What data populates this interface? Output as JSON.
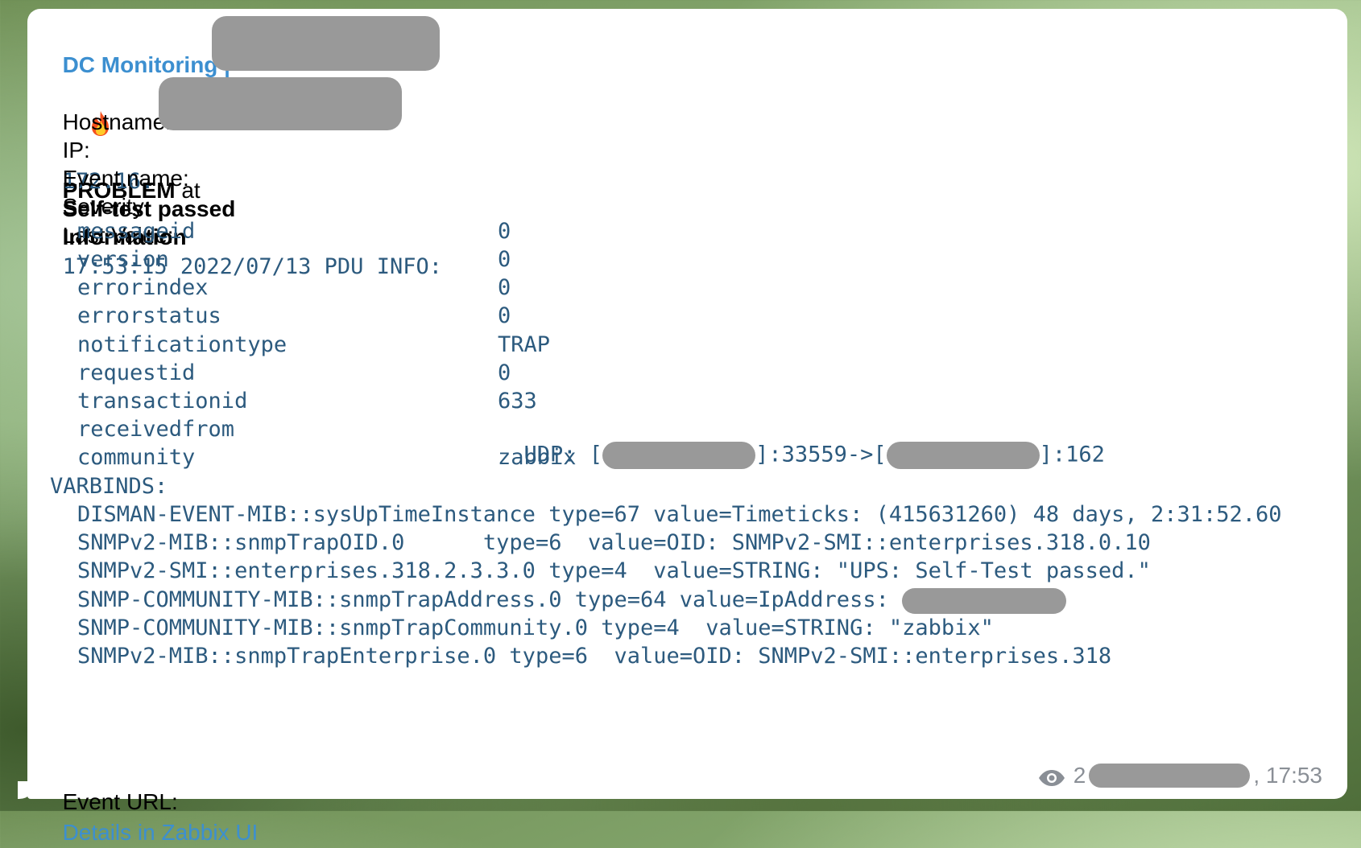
{
  "header": {
    "channel_title": "DC Monitoring |",
    "status_icon": "fire-icon",
    "status_label": "PROBLEM",
    "at_word": " at"
  },
  "fields": {
    "hostname_label": "Hostname:",
    "ip_label": "IP:",
    "ip_value": "172.16.",
    "event_name_label": "Event name:",
    "event_name_value": "Self-test passed",
    "severity_label": "Severity:",
    "severity_value": "Information",
    "last_value_label": "Last Value:",
    "last_value_header": "17:53:15 2022/07/13 PDU INFO:"
  },
  "pdu_info": [
    {
      "key": "messageid",
      "value": "0"
    },
    {
      "key": "version",
      "value": "0"
    },
    {
      "key": "errorindex",
      "value": "0"
    },
    {
      "key": "errorstatus",
      "value": "0"
    },
    {
      "key": "notificationtype",
      "value": "TRAP"
    },
    {
      "key": "requestid",
      "value": "0"
    },
    {
      "key": "transactionid",
      "value": "633"
    },
    {
      "key": "receivedfrom",
      "value": ""
    },
    {
      "key": "community",
      "value": "zabbix"
    }
  ],
  "received_from": {
    "prefix": "UDP: [",
    "middle": "]:33559->[",
    "suffix": "]:162"
  },
  "varbinds": {
    "label": "VARBINDS:",
    "lines": [
      "DISMAN-EVENT-MIB::sysUpTimeInstance type=67 value=Timeticks: (415631260) 48 days, 2:31:52.60",
      "SNMPv2-MIB::snmpTrapOID.0      type=6  value=OID: SNMPv2-SMI::enterprises.318.0.10",
      "SNMPv2-SMI::enterprises.318.2.3.3.0 type=4  value=STRING: \"UPS: Self-Test passed.\"",
      "SNMP-COMMUNITY-MIB::snmpTrapAddress.0 type=64 value=IpAddress: ",
      "SNMP-COMMUNITY-MIB::snmpTrapCommunity.0 type=4  value=STRING: \"zabbix\"",
      "SNMPv2-MIB::snmpTrapEnterprise.0 type=6  value=OID: SNMPv2-SMI::enterprises.318"
    ]
  },
  "event_url": {
    "label": "Event URL:",
    "link_text": "Details in Zabbix UI"
  },
  "meta": {
    "views_icon": "eye-icon",
    "views_prefix": "2",
    "time": ", 17:53"
  }
}
